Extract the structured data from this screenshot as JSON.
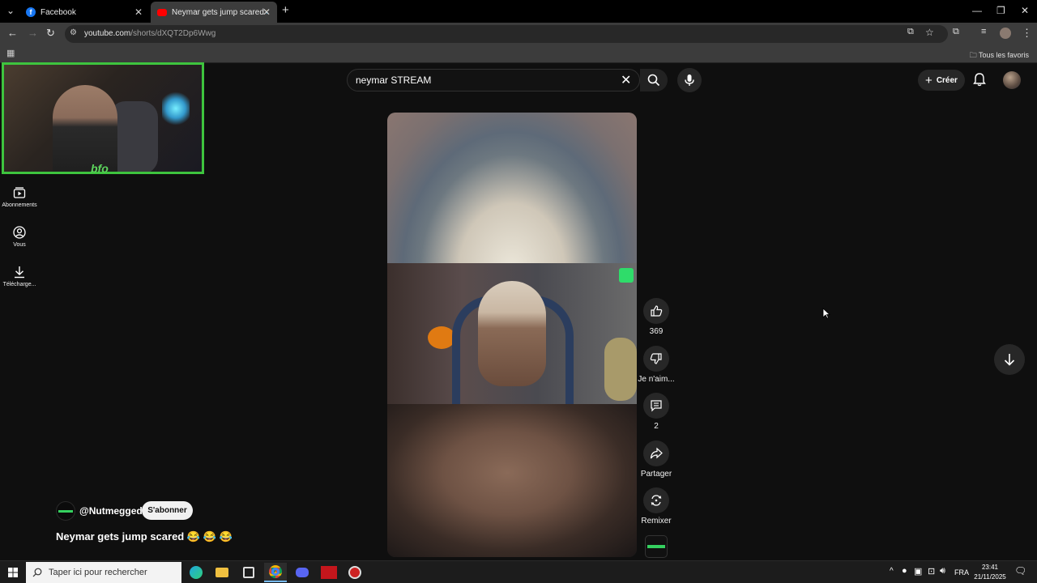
{
  "browser": {
    "tabs": [
      {
        "label": "Facebook",
        "active": false
      },
      {
        "label": "Neymar gets jump scared 😂 🔊",
        "active": true
      }
    ],
    "url_host": "youtube.com",
    "url_path": "/shorts/dXQT2Dp6Wwg",
    "bookmarks_folder": "Tous les favoris"
  },
  "youtube": {
    "search_value": "neymar STREAM",
    "create_label": "Créer",
    "guide": [
      {
        "label": "Abonnements",
        "icon": "subscriptions-icon"
      },
      {
        "label": "Vous",
        "icon": "you-icon"
      },
      {
        "label": "Télécharge...",
        "icon": "download-icon"
      }
    ],
    "actions": {
      "likes": "369",
      "dislike": "Je n'aim...",
      "comments": "2",
      "share": "Partager",
      "remix": "Remixer"
    },
    "channel_handle": "@Nutmeggedd",
    "subscribe_label": "S'abonner",
    "short_title": "Neymar gets jump scared 😂 😂 😂"
  },
  "taskbar": {
    "search_placeholder": "Taper ici pour rechercher",
    "lang": "FRA",
    "time": "23:41",
    "date": "21/11/2025"
  },
  "colors": {
    "accent_green": "#3ec43e",
    "youtube_red": "#ff0000"
  }
}
